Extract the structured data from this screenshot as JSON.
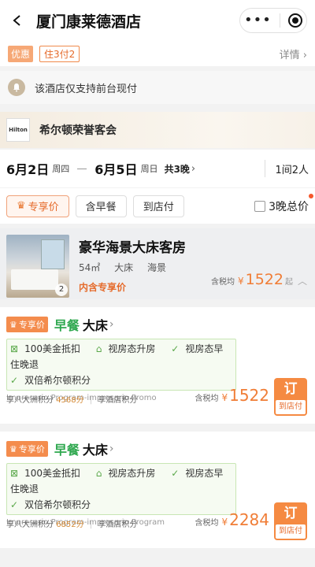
{
  "header": {
    "title": "厦门康莱德酒店",
    "menu_dots": "•••"
  },
  "promo": {
    "badge": "优惠",
    "stay_offer": "住3付2",
    "detail_link": "详情 ›"
  },
  "notice": {
    "text": "该酒店仅支持前台现付"
  },
  "hilton": {
    "logo_text": "Hilton",
    "title": "希尔顿荣誉客会"
  },
  "dates": {
    "checkin": "6月2日",
    "checkin_week": "周四",
    "checkout": "6月5日",
    "checkout_week": "周日",
    "nights": "共3晚",
    "chevron": "›",
    "rooms_guests": "1间2人"
  },
  "filters": {
    "chips": [
      {
        "label": "专享价",
        "active": true
      },
      {
        "label": "含早餐",
        "active": false
      },
      {
        "label": "到店付",
        "active": false
      }
    ],
    "total_label": "3晚总价"
  },
  "room": {
    "name": "豪华海景大床客房",
    "size": "54㎡",
    "bed": "大床",
    "view": "海景",
    "tag": "内含专享价",
    "photo_count": "2",
    "price_prefix": "含税均",
    "currency": "¥",
    "price": "1522",
    "price_suffix": "起",
    "collapse": "︿"
  },
  "offers": [
    {
      "badge": "专享价",
      "meal": "早餐",
      "bed": "大床",
      "perk1": "100美金抵扣",
      "perk2": "视房态升房",
      "perk3": "视房态早住晚退",
      "perk4": "双倍希尔顿积分",
      "program": "Impresario Program-impresario Promo",
      "points_label": "享八大洲积分",
      "points": "4568分",
      "hotel_points": "享酒店积分",
      "price_prefix": "含税均",
      "currency": "¥",
      "price": "1522",
      "book": "订",
      "pay": "到店付"
    },
    {
      "badge": "专享价",
      "meal": "早餐",
      "bed": "大床",
      "perk1": "100美金抵扣",
      "perk2": "视房态升房",
      "perk3": "视房态早住晚退",
      "perk4": "双倍希尔顿积分",
      "program": "Impresario Program-impresario Program",
      "points_label": "享八大洲积分",
      "points": "6852分",
      "hotel_points": "享酒店积分",
      "price_prefix": "含税均",
      "currency": "¥",
      "price": "2284",
      "book": "订",
      "pay": "到店付"
    }
  ],
  "colors": {
    "accent": "#f07d36",
    "breakfast": "#2fa84f",
    "perk_border": "#c8e6b4"
  }
}
